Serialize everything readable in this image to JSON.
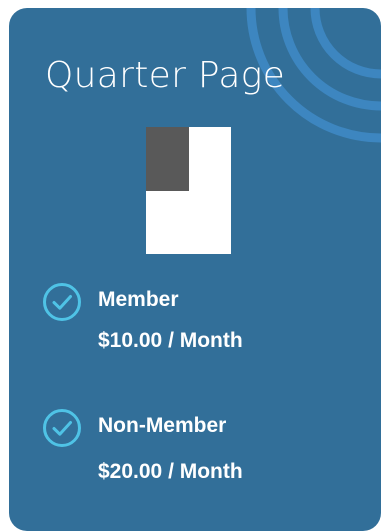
{
  "card": {
    "title": "Quarter Page",
    "background_color": "#326f99",
    "accent_color": "#4fc3e6",
    "ring_color": "#3d86c0",
    "thumbnail": {
      "icon": "quarter-page-layout-icon",
      "filled_fraction": 0.25,
      "page_color": "#ffffff",
      "filled_color": "#595959"
    },
    "tiers": [
      {
        "icon": "check-circle-icon",
        "label": "Member",
        "price": "$10.00 / Month"
      },
      {
        "icon": "check-circle-icon",
        "label": "Non-Member",
        "price": "$20.00 / Month"
      }
    ]
  }
}
